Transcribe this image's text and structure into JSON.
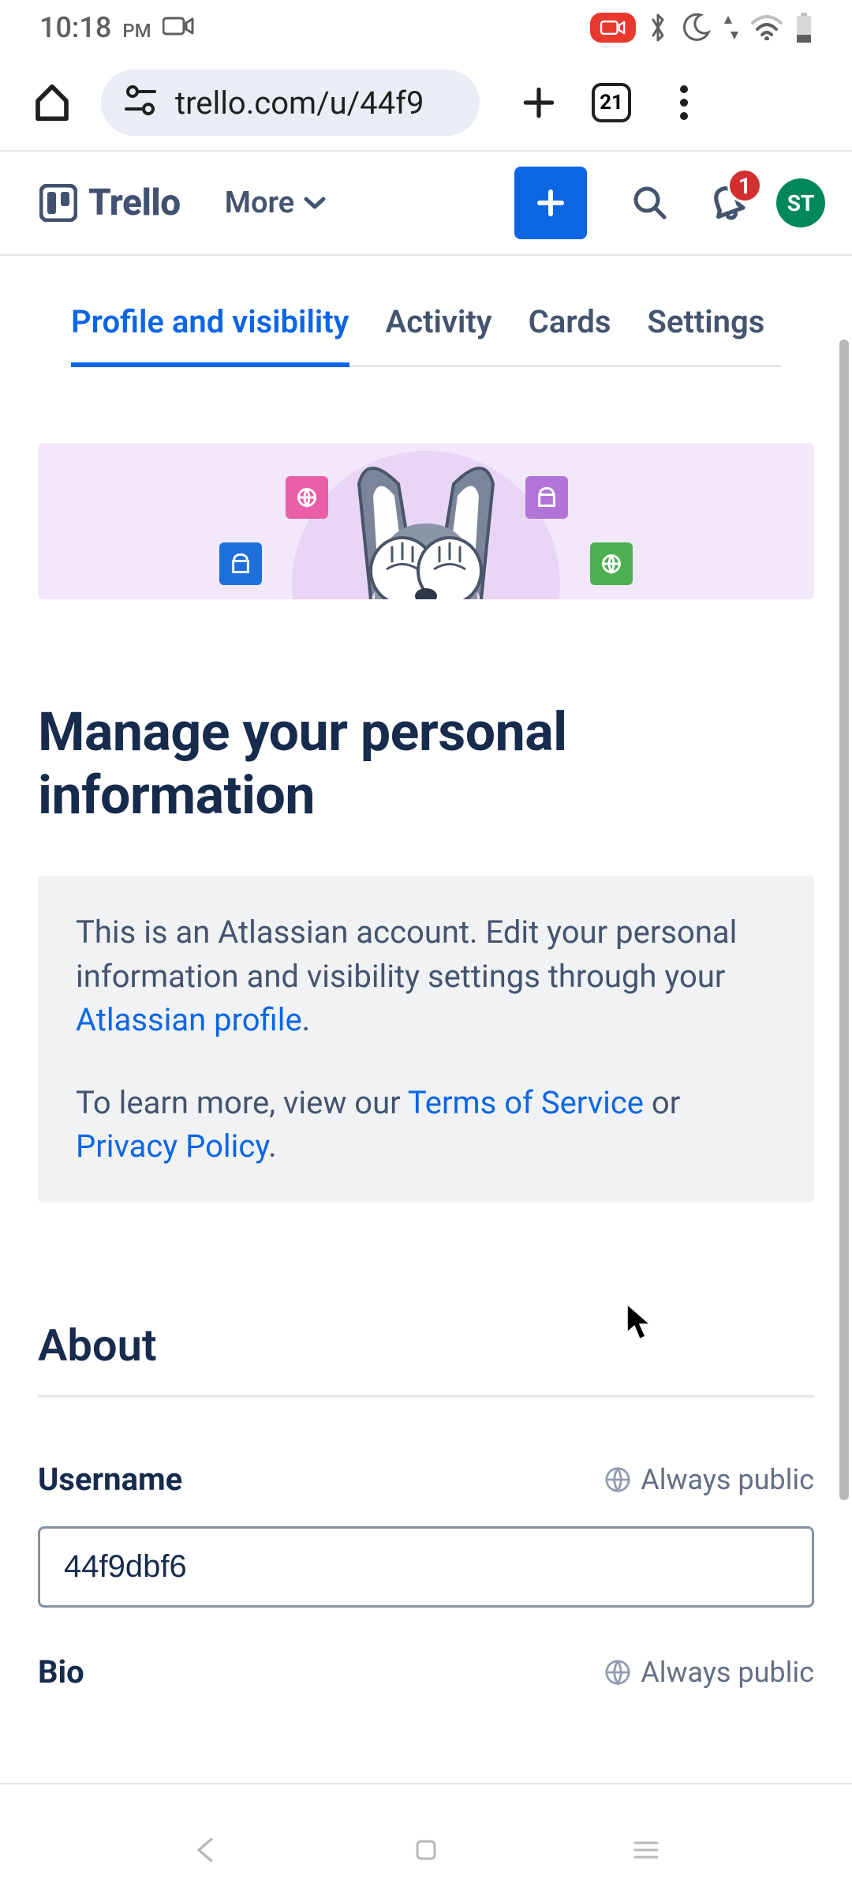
{
  "status": {
    "time": "10:18",
    "ampm": "PM"
  },
  "browser": {
    "url": "trello.com/u/44f9",
    "tab_count": "21"
  },
  "header": {
    "brand": "Trello",
    "more_label": "More",
    "notification_count": "1",
    "avatar_initials": "ST"
  },
  "tabs": {
    "items": [
      {
        "label": "Profile and visibility",
        "active": true
      },
      {
        "label": "Activity",
        "active": false
      },
      {
        "label": "Cards",
        "active": false
      },
      {
        "label": "Settings",
        "active": false
      }
    ]
  },
  "page": {
    "title": "Manage your personal information",
    "info_pre_link": "This is an Atlassian account. Edit your personal information and visibility settings through your ",
    "info_link1": "Atlassian profile",
    "info_post_link1": ".",
    "info2_pre": "To learn more, view our ",
    "info2_link_tos": "Terms of Service",
    "info2_mid": " or ",
    "info2_link_pp": "Privacy Policy",
    "info2_post": "."
  },
  "about": {
    "heading": "About",
    "username_label": "Username",
    "username_value": "44f9dbf6",
    "bio_label": "Bio",
    "visibility_label": "Always public"
  }
}
